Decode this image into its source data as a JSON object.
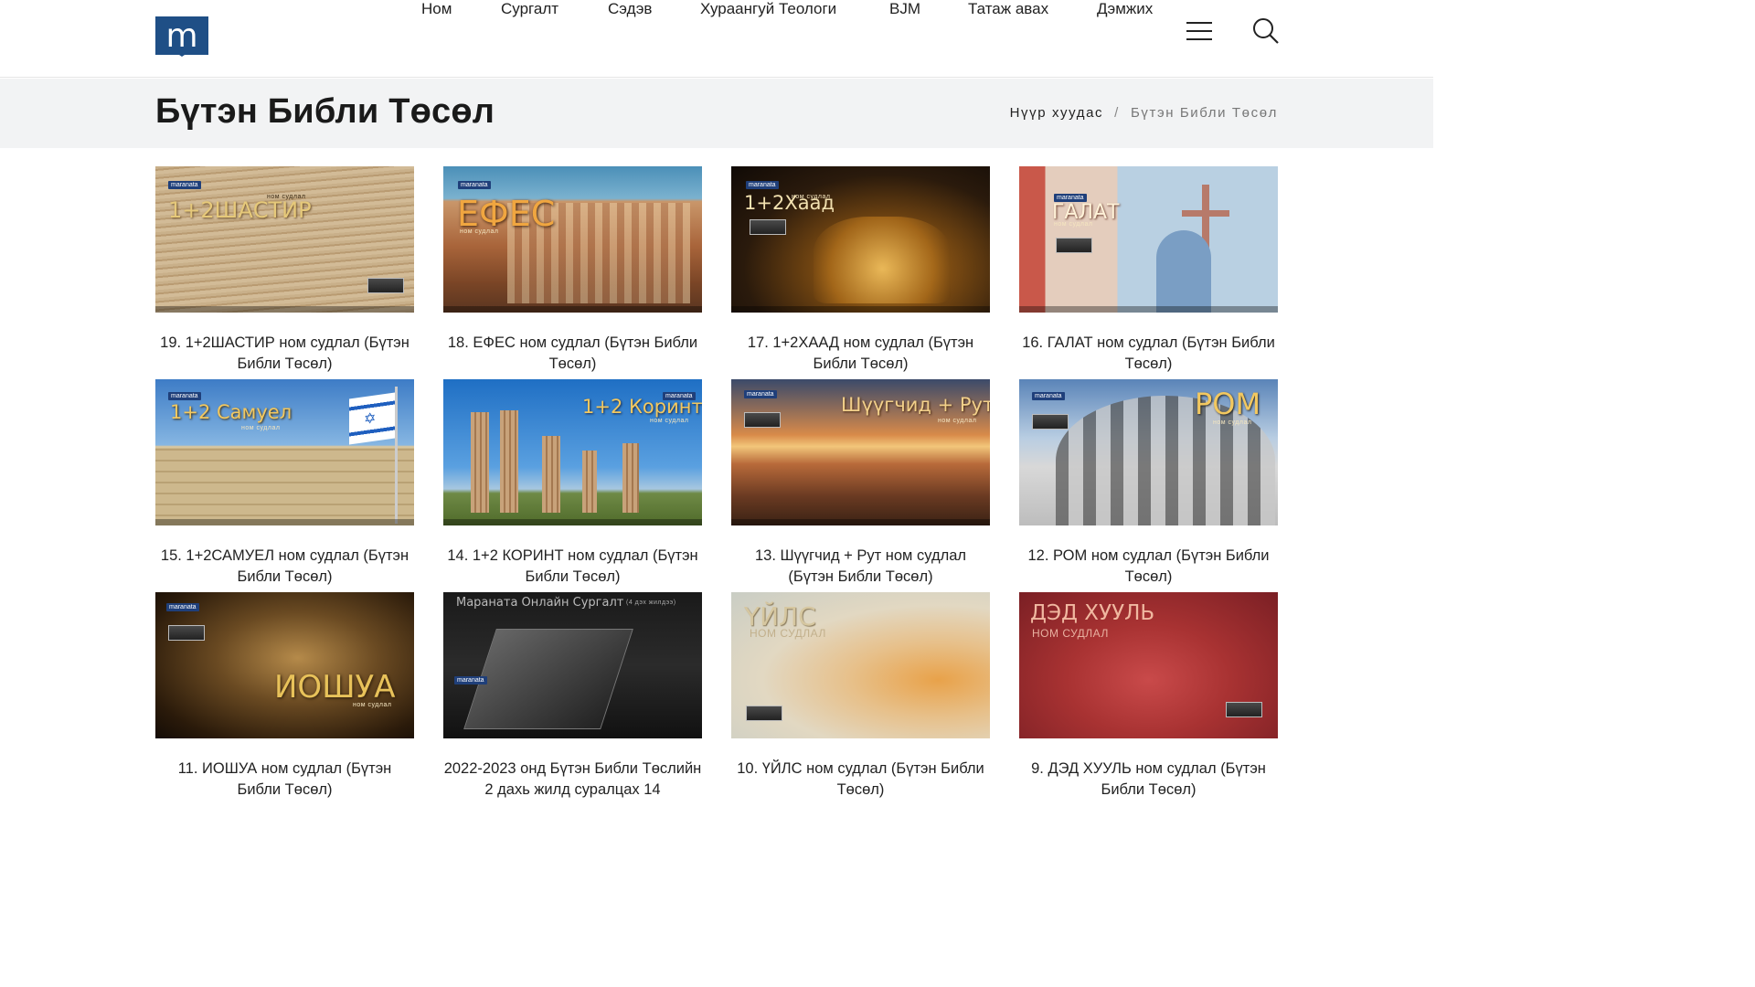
{
  "header": {
    "logo_letter": "m",
    "nav": [
      "Ном",
      "Сургалт",
      "Сэдэв",
      "Хураангуй Теологи",
      "BJM",
      "Татаж авах",
      "Дэмжих"
    ]
  },
  "page": {
    "title": "Бүтэн Библи Төсөл",
    "breadcrumb": {
      "home": "Нүүр хуудас",
      "separator": "/",
      "current": "Бүтэн Библи Төсөл"
    }
  },
  "colors": {
    "brand": "#1f4f86",
    "titlebar": "#f2f3f4"
  },
  "cards": [
    {
      "caption": "19. 1+2ШАСТИР ном судлал (Бүтэн Библи Төсөл)",
      "thumb_title": "1+2ШАСТИР",
      "thumb_sub": "ном судлал",
      "brand": "maranata"
    },
    {
      "caption": "18. ЕФЕС ном судлал (Бүтэн Библи Төсөл)",
      "thumb_title": "ЕФЕС",
      "thumb_sub": "ном судлал",
      "brand": "maranata"
    },
    {
      "caption": "17. 1+2ХААД ном судлал (Бүтэн Библи Төсөл)",
      "thumb_title": "1+2Хаад",
      "thumb_sub": "ном судлал",
      "brand": "maranata"
    },
    {
      "caption": "16. ГАЛАТ ном судлал (Бүтэн Библи Төсөл)",
      "thumb_title": "ГАЛАТ",
      "thumb_sub": "ном судлал",
      "brand": "maranata"
    },
    {
      "caption": "15. 1+2САМУЕЛ ном судлал (Бүтэн Библи Төсөл)",
      "thumb_title": "1+2 Самуел",
      "thumb_sub": "ном судлал",
      "brand": "maranata"
    },
    {
      "caption": "14. 1+2 КОРИНТ ном судлал (Бүтэн Библи Төсөл)",
      "thumb_title": "1+2 Коринт",
      "thumb_sub": "ном судлал",
      "brand": "maranata"
    },
    {
      "caption": "13. Шүүгчид + Рут ном судлал (Бүтэн Библи Төсөл)",
      "thumb_title": "Шүүгчид + Рут",
      "thumb_sub": "ном судлал",
      "brand": "maranata"
    },
    {
      "caption": "12. РОМ ном судлал (Бүтэн Библи Төсөл)",
      "thumb_title": "РОМ",
      "thumb_sub": "ном судлал",
      "brand": "maranata"
    },
    {
      "caption": "11. ИОШУА ном судлал (Бүтэн Библи Төсөл)",
      "thumb_title": "ИОШУА",
      "thumb_sub": "ном судлал",
      "brand": "maranata"
    },
    {
      "caption": "2022-2023 онд Бүтэн Библи Төслийн 2 дахь жилд суралцах 14",
      "thumb_title": "Маранатa Онлайн Сургалт",
      "thumb_sub": "(4 дэх жилдээ)",
      "brand": "maranata"
    },
    {
      "caption": "10. ҮЙЛС ном судлал (Бүтэн Библи Төсөл)",
      "thumb_title": "ҮЙЛС",
      "thumb_sub": "НОМ СУДЛАЛ",
      "brand": ""
    },
    {
      "caption": "9. ДЭД ХУУЛЬ ном судлал (Бүтэн Библи Төсөл)",
      "thumb_title": "ДЭД ХУУЛЬ",
      "thumb_sub": "НОМ СУДЛАЛ",
      "brand": ""
    }
  ]
}
